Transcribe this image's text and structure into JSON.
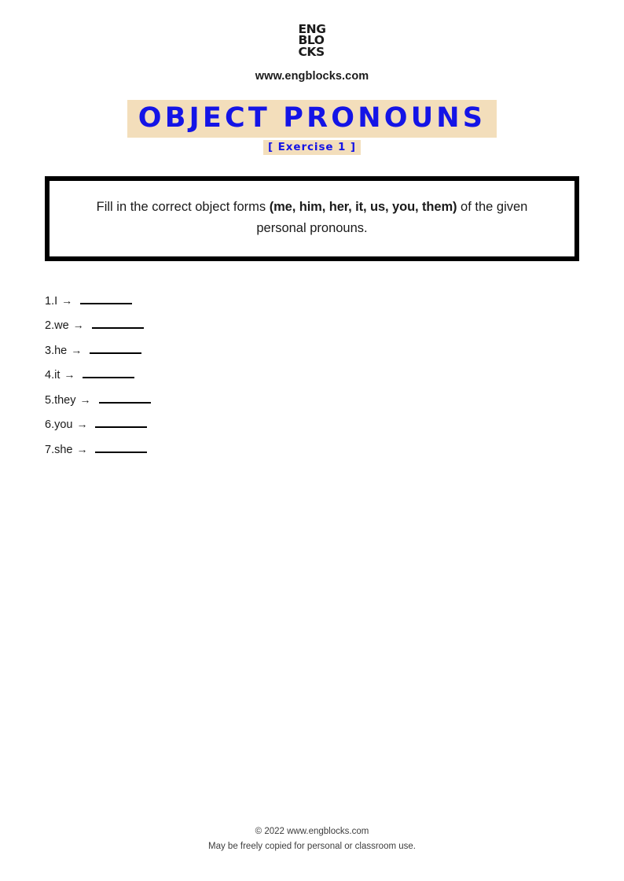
{
  "header": {
    "logo_lines": [
      "ENG",
      "BLO",
      "CKS"
    ],
    "logo_alt": "engblocks-logo",
    "site_url": "www.engblocks.com"
  },
  "title": {
    "main": "OBJECT PRONOUNS",
    "subtitle": "[ Exercise 1 ]",
    "highlight_color": "#f3debb",
    "text_color": "#1414e6"
  },
  "instructions": {
    "part1": "Fill in the correct object forms ",
    "bold": "(me, him, her, it, us, you, them)",
    "part2": " of the given personal pronouns.",
    "border_color": "#000000"
  },
  "exercise": {
    "items": [
      {
        "number": "1.",
        "prompt": "I",
        "arrow": "→",
        "answer": ""
      },
      {
        "number": "2.",
        "prompt": "we",
        "arrow": "→",
        "answer": ""
      },
      {
        "number": "3.",
        "prompt": "he",
        "arrow": "→",
        "answer": ""
      },
      {
        "number": "4.",
        "prompt": "it",
        "arrow": "→",
        "answer": ""
      },
      {
        "number": "5.",
        "prompt": "they",
        "arrow": "→",
        "answer": ""
      },
      {
        "number": "6.",
        "prompt": "you",
        "arrow": "→",
        "answer": ""
      },
      {
        "number": "7.",
        "prompt": "she",
        "arrow": "→",
        "answer": ""
      }
    ]
  },
  "footer": {
    "copyright": "© 2022 www.engblocks.com",
    "note": "May be freely copied for personal or classroom use."
  }
}
